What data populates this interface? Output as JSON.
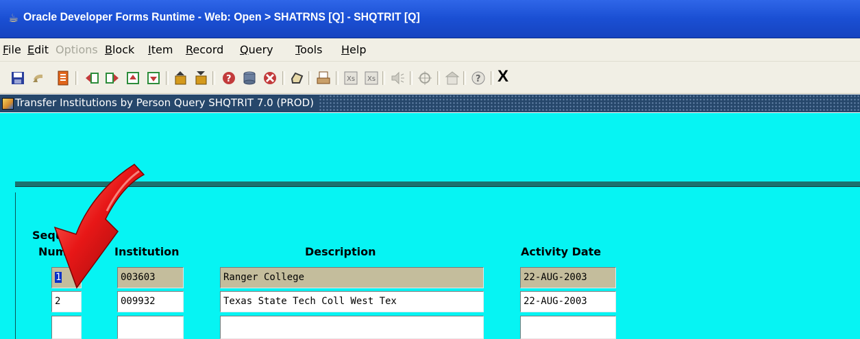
{
  "window": {
    "title": "Oracle Developer Forms Runtime - Web:  Open > SHATRNS [Q] - SHQTRIT [Q]"
  },
  "menu": {
    "items": [
      {
        "pre": "",
        "mnemonic": "F",
        "post": "ile",
        "enabled": true
      },
      {
        "pre": "",
        "mnemonic": "E",
        "post": "dit",
        "enabled": true
      },
      {
        "pre": "",
        "mnemonic": "O",
        "post": "ptions",
        "enabled": false
      },
      {
        "pre": "",
        "mnemonic": "B",
        "post": "lock",
        "enabled": true
      },
      {
        "pre": "",
        "mnemonic": "I",
        "post": "tem",
        "enabled": true
      },
      {
        "pre": "",
        "mnemonic": "R",
        "post": "ecord",
        "enabled": true
      },
      {
        "pre": "",
        "mnemonic": "Q",
        "post": "uery",
        "enabled": true
      },
      {
        "pre": "",
        "mnemonic": "T",
        "post": "ools",
        "enabled": true
      },
      {
        "pre": "",
        "mnemonic": "H",
        "post": "elp",
        "enabled": true
      }
    ]
  },
  "toolbar": {
    "buttons": [
      {
        "icon": "save-icon",
        "color": "#2a3f9c"
      },
      {
        "icon": "rollback-icon",
        "color": "#c9b27a"
      },
      {
        "icon": "print-doc-icon",
        "color": "#e0651b"
      },
      {
        "icon": "previous-block-icon",
        "color": "#c23b3b"
      },
      {
        "icon": "next-block-icon",
        "color": "#c23b3b"
      },
      {
        "icon": "first-record-icon",
        "color": "#2c8c3a"
      },
      {
        "icon": "last-record-icon",
        "color": "#2c8c3a"
      },
      {
        "icon": "insert-record-icon",
        "color": "#d49a1c"
      },
      {
        "icon": "remove-record-icon",
        "color": "#d49a1c"
      },
      {
        "icon": "enter-query-icon",
        "color": "#c23b3b"
      },
      {
        "icon": "execute-query-icon",
        "color": "#5b6f8c"
      },
      {
        "icon": "cancel-query-icon",
        "color": "#c23b3b"
      },
      {
        "icon": "count-query-icon",
        "color": "#3a3a3a"
      },
      {
        "icon": "print-icon",
        "color": "#7a4a1a"
      },
      {
        "icon": "extract-icon",
        "color": "#8a8a8a"
      },
      {
        "icon": "extract-all-icon",
        "color": "#8a8a8a"
      },
      {
        "icon": "speaker-icon",
        "color": "#a3a39a"
      },
      {
        "icon": "target-icon",
        "color": "#a3a39a"
      },
      {
        "icon": "building-icon",
        "color": "#a3a39a"
      },
      {
        "icon": "help-icon",
        "color": "#8a8a8a"
      }
    ],
    "close_label": "X"
  },
  "form": {
    "title": "Transfer Institutions by Person Query  SHQTRIT  7.0  (PROD)"
  },
  "grid": {
    "headers": {
      "seq_line1": "Seque",
      "seq_line2": "Num",
      "institution": "Institution",
      "description": "Description",
      "activity_date": "Activity Date"
    },
    "rows": [
      {
        "seq": "1",
        "institution": "003603",
        "description": "Ranger College",
        "activity_date": "22-AUG-2003",
        "selected": true
      },
      {
        "seq": "2",
        "institution": "009932",
        "description": "Texas State Tech Coll West Tex",
        "activity_date": "22-AUG-2003",
        "selected": false
      },
      {
        "seq": "",
        "institution": "",
        "description": "",
        "activity_date": "",
        "selected": false
      }
    ]
  },
  "colors": {
    "title_bar": "#1a4fd3",
    "canvas": "#06f4f3",
    "selected_row": "#c4bd9c",
    "arrow": "#e81717"
  }
}
